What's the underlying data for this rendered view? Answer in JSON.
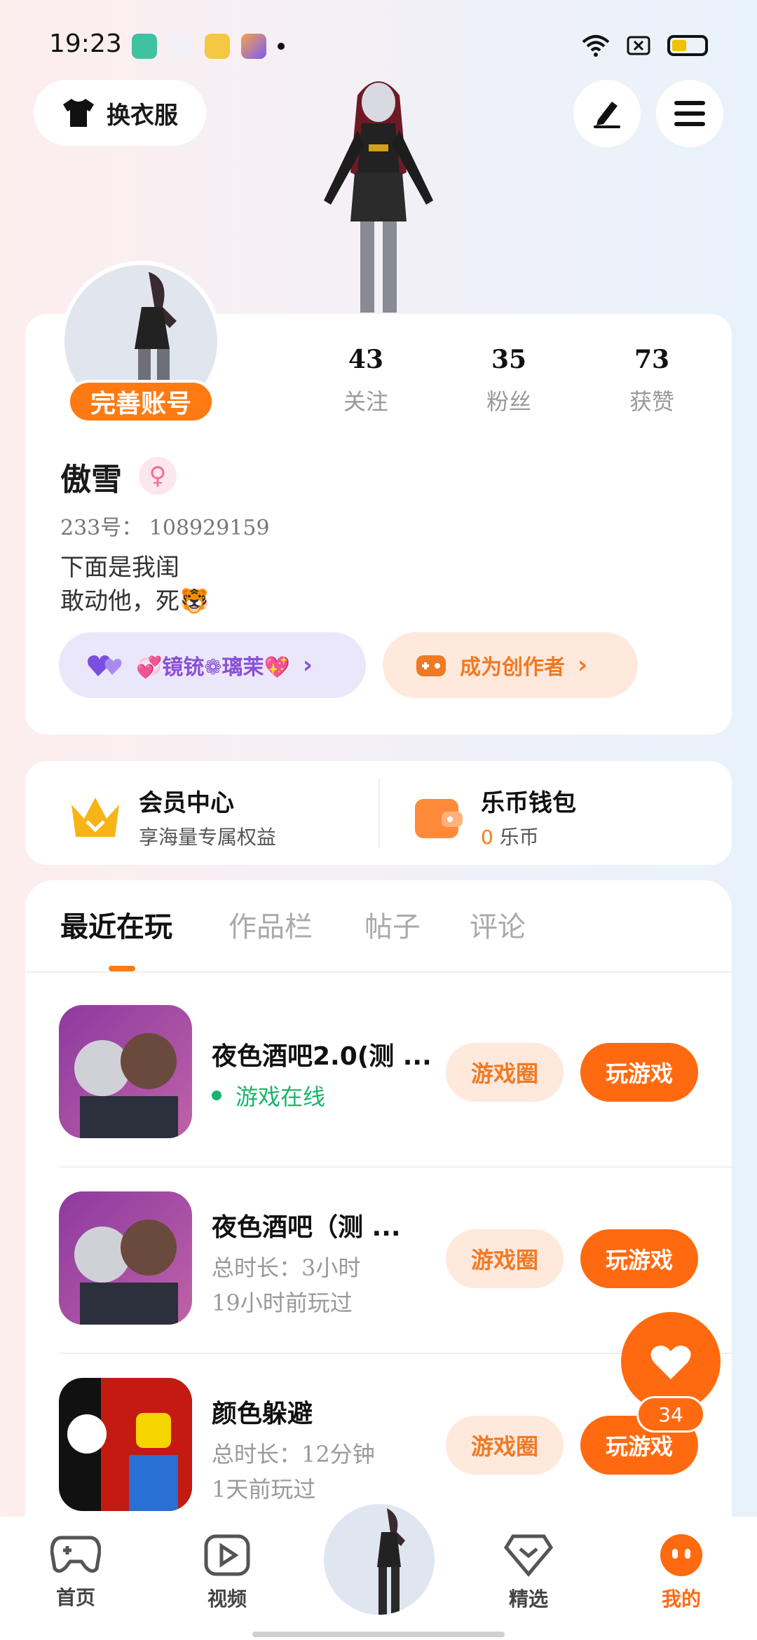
{
  "status_bar": {
    "time": "19:23"
  },
  "top": {
    "outfit_label": "换衣服"
  },
  "profile": {
    "complete_label": "完善账号",
    "stats": [
      {
        "value": "43",
        "label": "关注"
      },
      {
        "value": "35",
        "label": "粉丝"
      },
      {
        "value": "73",
        "label": "获赞"
      }
    ],
    "username": "傲雪",
    "gender_icon": "♀",
    "uid": "233号： 108929159",
    "bio_line1": "下面是我闺",
    "bio_line2": "敢动他，死🐯",
    "badge_label": "💞镜铳❁璃茉💖",
    "creator_label": "成为创作者"
  },
  "features": {
    "member_title": "会员中心",
    "member_sub": "享海量专属权益",
    "wallet_title": "乐币钱包",
    "wallet_amount": "0",
    "wallet_unit": "乐币"
  },
  "tabs": [
    "最近在玩",
    "作品栏",
    "帖子",
    "评论"
  ],
  "games": [
    {
      "title": "夜色酒吧2.0(测 ...",
      "status": "游戏在线",
      "circle_label": "游戏圈",
      "play_label": "玩游戏"
    },
    {
      "title": "夜色酒吧（测 ...",
      "duration": "总时长：3小时",
      "last_played": "19小时前玩过",
      "circle_label": "游戏圈",
      "play_label": "玩游戏"
    },
    {
      "title": "颜色躲避",
      "duration": "总时长：12分钟",
      "last_played": "1天前玩过",
      "circle_label": "游戏圈",
      "play_label": "玩游戏"
    }
  ],
  "like_count": "34",
  "nav": [
    {
      "label": "首页"
    },
    {
      "label": "视频"
    },
    {
      "label": "精选"
    },
    {
      "label": "我的"
    }
  ],
  "colors": {
    "accent": "#ff6a10",
    "online": "#19b56b",
    "purple": "#8a4fd7"
  }
}
